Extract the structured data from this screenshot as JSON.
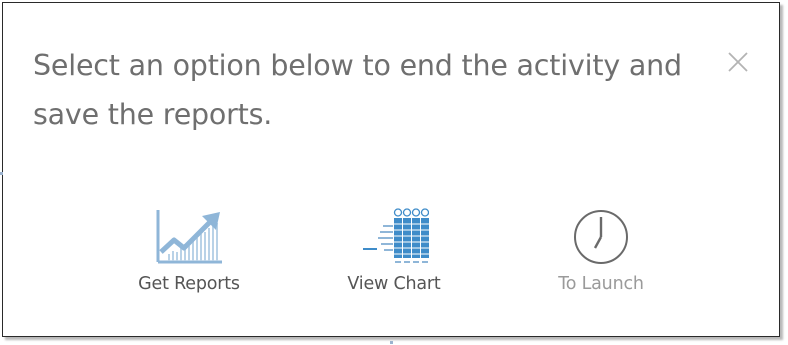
{
  "dialog": {
    "message": "Select an option below to end the activity and save the reports.",
    "close_icon": "close-icon"
  },
  "options": [
    {
      "label": "Get Reports",
      "icon": "rising-bar-chart-icon",
      "enabled": true
    },
    {
      "label": "View Chart",
      "icon": "results-grid-chart-icon",
      "enabled": true
    },
    {
      "label": "To Launch",
      "icon": "clock-icon",
      "enabled": false
    }
  ],
  "colors": {
    "icon_blue": "#8fb6d8",
    "icon_blue_dark": "#3f8cc9",
    "text": "#6f6f6f",
    "label": "#555555",
    "disabled": "#9a9a9a"
  }
}
